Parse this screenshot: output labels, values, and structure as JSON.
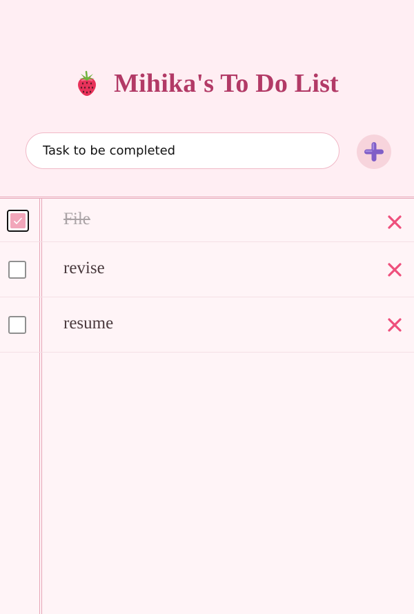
{
  "header": {
    "title": "Mihika's To Do List",
    "title_icon": "strawberry-icon"
  },
  "input": {
    "placeholder": "Task to be completed",
    "value": ""
  },
  "add_button": {
    "icon": "plus-icon"
  },
  "tasks": [
    {
      "text": "File",
      "checked": true
    },
    {
      "text": "revise",
      "checked": false
    },
    {
      "text": "resume",
      "checked": false
    }
  ],
  "colors": {
    "background": "#ffeef3",
    "paper": "#fff4f7",
    "title": "#b23a66",
    "accent_pink": "#f2a6ba",
    "delete_x": "#ee4f7c",
    "plus": "#7f5ec7"
  }
}
